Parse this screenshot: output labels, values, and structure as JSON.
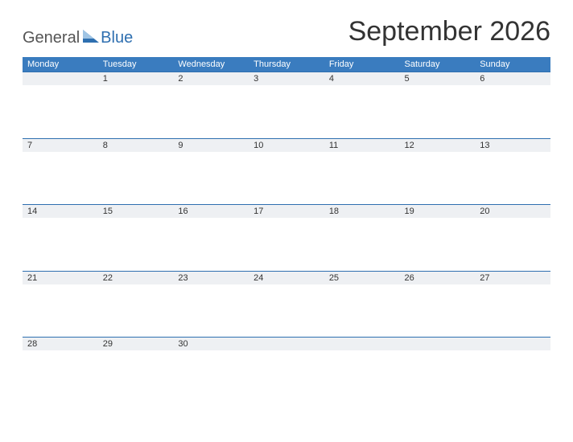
{
  "logo": {
    "part1": "General",
    "part2": "Blue"
  },
  "title": "September 2026",
  "colors": {
    "accent": "#3a7cbf",
    "stripe": "#eef0f3"
  },
  "day_headers": [
    "Monday",
    "Tuesday",
    "Wednesday",
    "Thursday",
    "Friday",
    "Saturday",
    "Sunday"
  ],
  "weeks": [
    {
      "dates": [
        "",
        "1",
        "2",
        "3",
        "4",
        "5",
        "6"
      ]
    },
    {
      "dates": [
        "7",
        "8",
        "9",
        "10",
        "11",
        "12",
        "13"
      ]
    },
    {
      "dates": [
        "14",
        "15",
        "16",
        "17",
        "18",
        "19",
        "20"
      ]
    },
    {
      "dates": [
        "21",
        "22",
        "23",
        "24",
        "25",
        "26",
        "27"
      ]
    },
    {
      "dates": [
        "28",
        "29",
        "30",
        "",
        "",
        "",
        ""
      ]
    }
  ]
}
